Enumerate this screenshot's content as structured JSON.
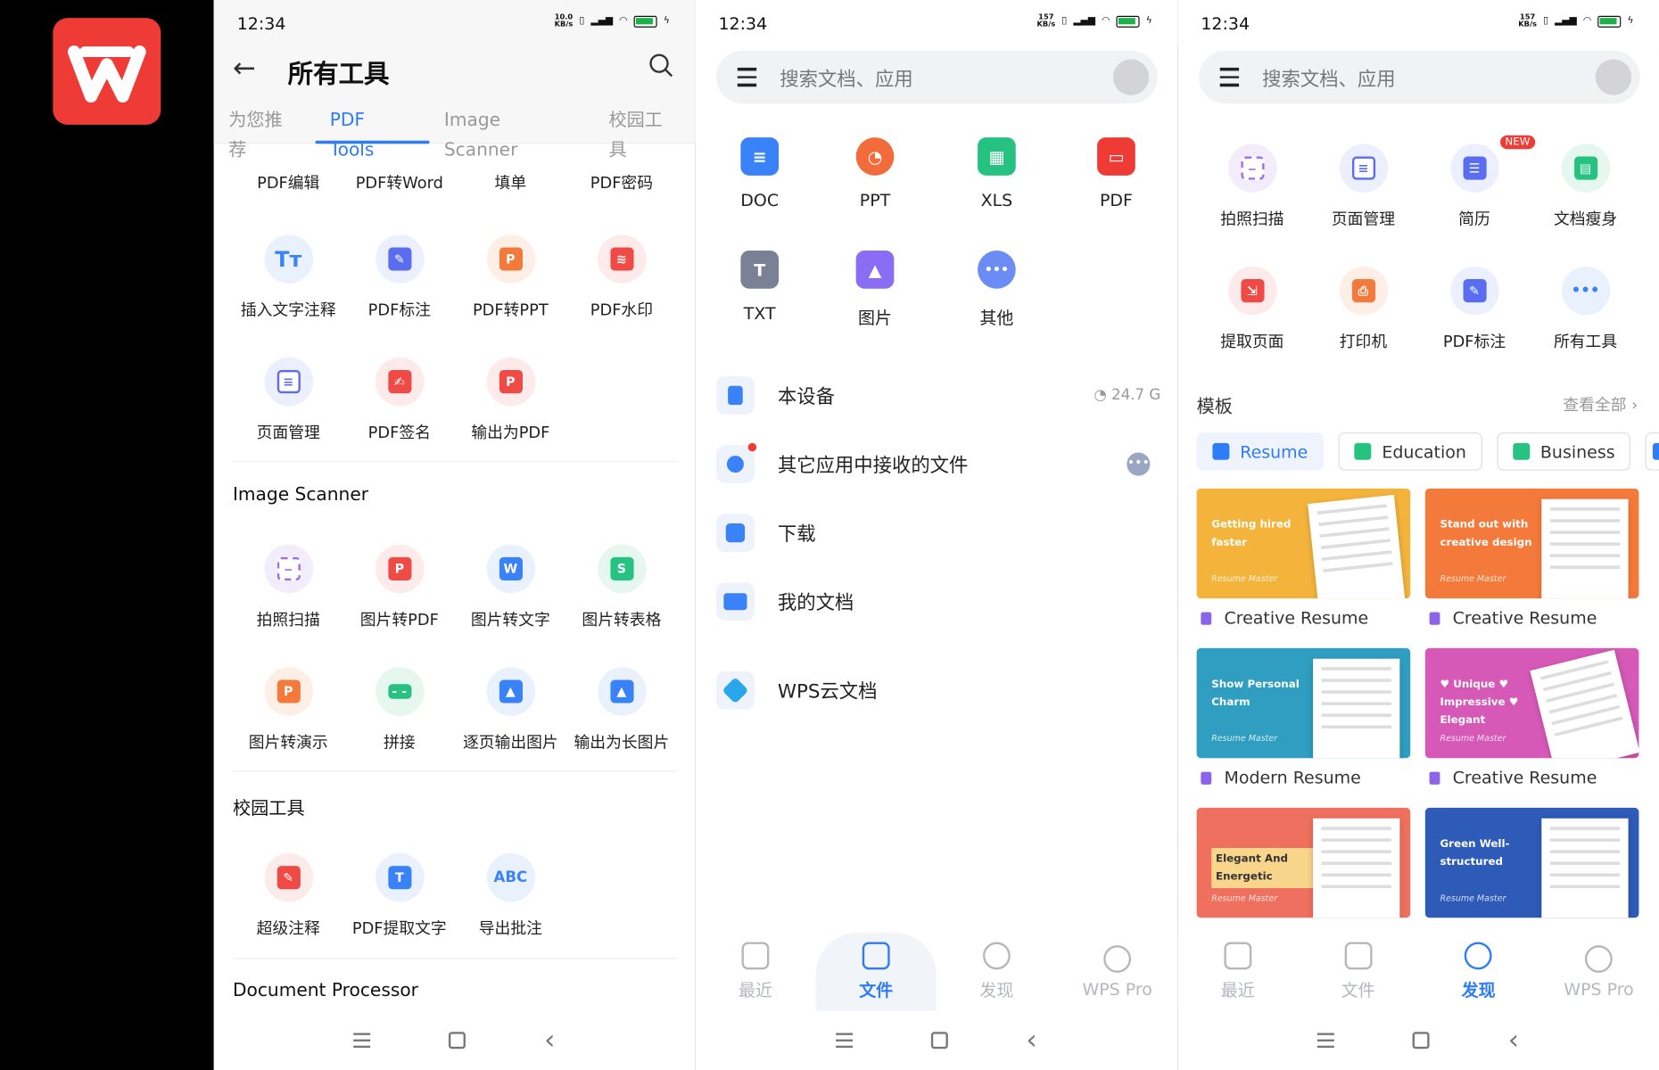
{
  "status_bar": {
    "time": "12:34",
    "speed_1": "10.0",
    "speed_2": "157",
    "speed_unit": "KB/s",
    "battery": "95"
  },
  "colors": {
    "brand_red": "#ef3b35",
    "accent_blue": "#2e7cf6"
  },
  "screen1": {
    "title": "所有工具",
    "tabs": [
      "为您推荐",
      "PDF Tools",
      "Image Scanner",
      "校园工具"
    ],
    "pdf_tools": [
      {
        "label": "PDF编辑",
        "icon": "pdf-edit-icon"
      },
      {
        "label": "PDF转Word",
        "icon": "pdf-to-word-icon"
      },
      {
        "label": "填单",
        "icon": "fill-form-icon"
      },
      {
        "label": "PDF密码",
        "icon": "pdf-password-icon"
      },
      {
        "label": "插入文字注释",
        "icon": "text-annotation-icon",
        "glyph": "Tт"
      },
      {
        "label": "PDF标注",
        "icon": "pdf-markup-icon"
      },
      {
        "label": "PDF转PPT",
        "icon": "pdf-to-ppt-icon"
      },
      {
        "label": "PDF水印",
        "icon": "pdf-watermark-icon"
      },
      {
        "label": "页面管理",
        "icon": "page-manage-icon"
      },
      {
        "label": "PDF签名",
        "icon": "pdf-sign-icon"
      },
      {
        "label": "输出为PDF",
        "icon": "export-pdf-icon"
      }
    ],
    "section_image": "Image Scanner",
    "image_tools": [
      {
        "label": "拍照扫描",
        "icon": "photo-scan-icon"
      },
      {
        "label": "图片转PDF",
        "icon": "image-to-pdf-icon"
      },
      {
        "label": "图片转文字",
        "icon": "image-to-text-icon"
      },
      {
        "label": "图片转表格",
        "icon": "image-to-table-icon"
      },
      {
        "label": "图片转演示",
        "icon": "image-to-ppt-icon"
      },
      {
        "label": "拼接",
        "icon": "stitch-icon"
      },
      {
        "label": "逐页输出图片",
        "icon": "export-pages-image-icon"
      },
      {
        "label": "输出为长图片",
        "icon": "export-long-image-icon"
      }
    ],
    "section_campus": "校园工具",
    "campus_tools": [
      {
        "label": "超级注释",
        "icon": "super-annotate-icon"
      },
      {
        "label": "PDF提取文字",
        "icon": "pdf-extract-text-icon"
      },
      {
        "label": "导出批注",
        "icon": "export-comments-icon",
        "glyph": "ABC"
      }
    ],
    "section_doc": "Document Processor"
  },
  "screen2": {
    "search_placeholder": "搜索文档、应用",
    "file_types": [
      {
        "label": "DOC",
        "icon": "doc-icon",
        "color": "#3a82f7"
      },
      {
        "label": "PPT",
        "icon": "ppt-icon",
        "color": "#f36b3a"
      },
      {
        "label": "XLS",
        "icon": "xls-icon",
        "color": "#25c281"
      },
      {
        "label": "PDF",
        "icon": "pdf-icon",
        "color": "#ef3b35"
      },
      {
        "label": "TXT",
        "icon": "txt-icon",
        "color": "#7a8196",
        "glyph": "T"
      },
      {
        "label": "图片",
        "icon": "image-icon",
        "color": "#8a6cf5"
      },
      {
        "label": "其他",
        "icon": "other-icon",
        "color": "#6b8cf5",
        "glyph": "•••"
      }
    ],
    "locations": [
      {
        "label": "本设备",
        "meta": "24.7 G",
        "icon": "phone-device-icon"
      },
      {
        "label": "其它应用中接收的文件",
        "icon": "received-files-icon"
      },
      {
        "label": "下载",
        "icon": "download-icon"
      },
      {
        "label": "我的文档",
        "icon": "folder-icon"
      },
      {
        "label": "WPS云文档",
        "icon": "cloud-doc-icon"
      }
    ],
    "bottom_nav": [
      "最近",
      "文件",
      "发现",
      "WPS Pro"
    ]
  },
  "screen3": {
    "search_placeholder": "搜索文档、应用",
    "tools": [
      {
        "label": "拍照扫描",
        "icon": "photo-scan-icon"
      },
      {
        "label": "页面管理",
        "icon": "page-manage-icon"
      },
      {
        "label": "简历",
        "icon": "resume-icon",
        "badge": "NEW"
      },
      {
        "label": "文档瘦身",
        "icon": "doc-slim-icon"
      },
      {
        "label": "提取页面",
        "icon": "extract-page-icon"
      },
      {
        "label": "打印机",
        "icon": "printer-icon"
      },
      {
        "label": "PDF标注",
        "icon": "pdf-markup-icon"
      },
      {
        "label": "所有工具",
        "icon": "all-tools-icon",
        "glyph": "•••"
      }
    ],
    "templates_title": "模板",
    "view_all": "查看全部",
    "chips": [
      "Resume",
      "Education",
      "Business"
    ],
    "cards": [
      {
        "title": "Creative Resume",
        "text": "Getting hired faster",
        "tag": "Resume Master",
        "color": "#f4b43c"
      },
      {
        "title": "Creative Resume",
        "text": "Stand out with creative design",
        "tag": "Resume Master",
        "color": "#f47a3c"
      },
      {
        "title": "Modern Resume",
        "text": "Show Personal Charm",
        "tag": "Resume Master",
        "color": "#2f9ec0"
      },
      {
        "title": "Creative Resume",
        "text": "♥ Unique ♥ Impressive ♥ Elegant",
        "tag": "Resume Master",
        "color": "#d659b8"
      },
      {
        "title": "",
        "text": "Elegant And Energetic",
        "tag": "Resume Master",
        "color": "#f0705f"
      },
      {
        "title": "",
        "text": "Green Well-structured",
        "tag": "Resume Master",
        "color": "#2e5bb8"
      }
    ],
    "bottom_nav": [
      "最近",
      "文件",
      "发现",
      "WPS Pro"
    ]
  }
}
